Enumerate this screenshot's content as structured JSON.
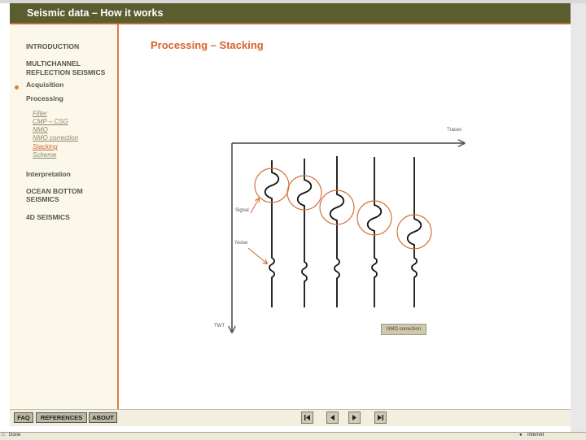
{
  "header": {
    "title": "Seismic data – How it works"
  },
  "sidebar": {
    "nav": {
      "introduction": "INTRODUCTION",
      "multichannel_1": "MULTICHANNEL",
      "multichannel_2": "REFLECTION SEISMICS",
      "acquisition": "Acquisition",
      "processing": "Processing",
      "interpretation": "Interpretation",
      "obs_1": "OCEAN BOTTOM",
      "obs_2": "SEISMICS",
      "seismics_4d": "4D SEISMICS"
    },
    "processing_items": [
      "Filter",
      "CMP – CSG",
      "NMO",
      "NMO correction",
      "Stacking",
      "Scheme"
    ],
    "active_item": "Stacking"
  },
  "main": {
    "title": "Processing – Stacking",
    "diagram": {
      "axis_x_label": "Traces",
      "axis_y_label": "TWT",
      "signal_label": "Signal",
      "noise_label": "Noise",
      "button_label": "NMO correction"
    }
  },
  "footer": {
    "tabs": {
      "faq": "FAQ",
      "references": "REFERENCES",
      "about": "ABOUT"
    },
    "nav_icons": [
      "first-icon",
      "previous-icon",
      "next-icon",
      "last-icon"
    ]
  },
  "statusbar": {
    "left": "Done",
    "right": "Internet"
  },
  "colors": {
    "header": "#5a5e2e",
    "accent": "#e07a44",
    "sidebar_bg": "#fbf8ea"
  }
}
